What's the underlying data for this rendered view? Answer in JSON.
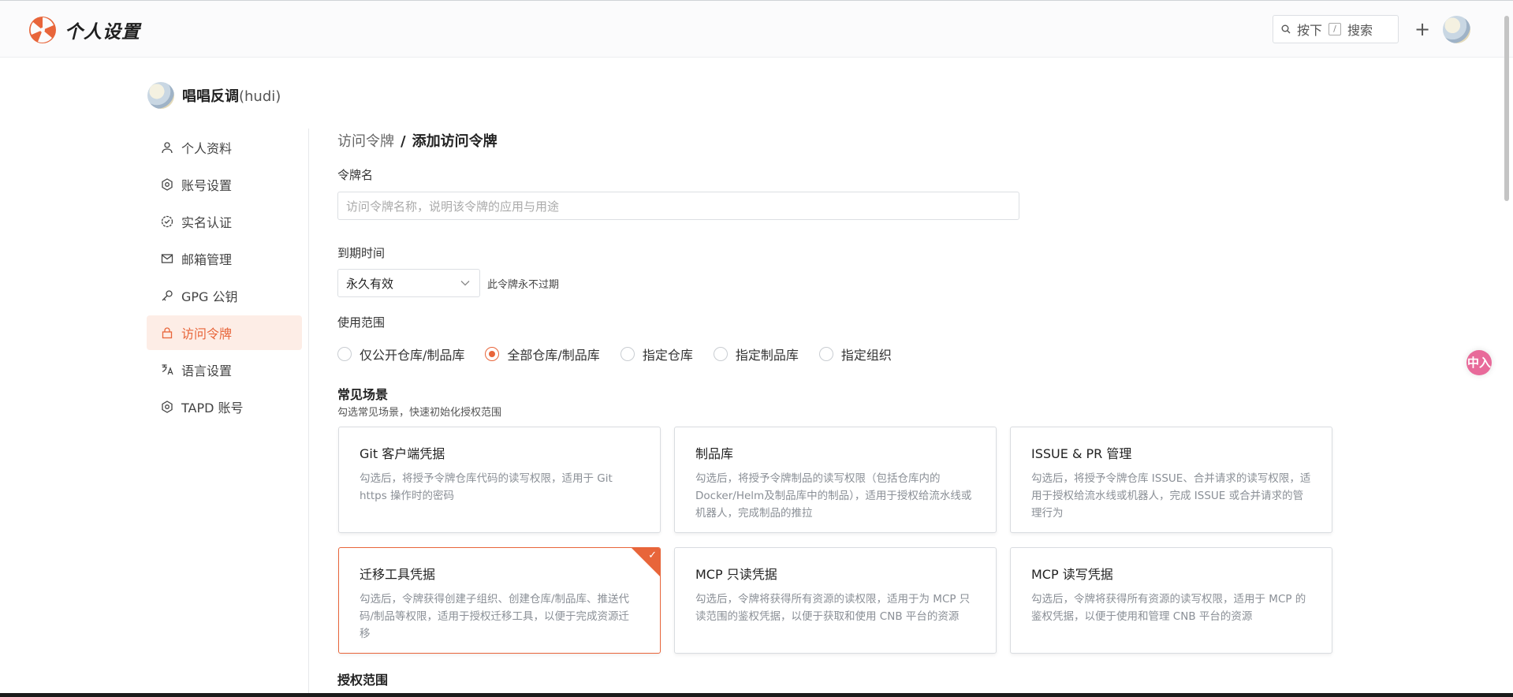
{
  "header": {
    "app_title": "个人设置",
    "search": {
      "prefix": "按下",
      "key": "/",
      "suffix": "搜索"
    },
    "plus_label": "+"
  },
  "profile": {
    "name": "唱唱反调",
    "handle": "(hudi)"
  },
  "sidebar": {
    "items": [
      {
        "label": "个人资料",
        "icon": "user-icon",
        "active": false
      },
      {
        "label": "账号设置",
        "icon": "gear-icon",
        "active": false
      },
      {
        "label": "实名认证",
        "icon": "verified-badge-icon",
        "active": false
      },
      {
        "label": "邮箱管理",
        "icon": "mail-icon",
        "active": false
      },
      {
        "label": "GPG 公钥",
        "icon": "key-icon",
        "active": false
      },
      {
        "label": "访问令牌",
        "icon": "lock-icon",
        "active": true
      },
      {
        "label": "语言设置",
        "icon": "language-icon",
        "active": false
      },
      {
        "label": "TAPD 账号",
        "icon": "gear-icon",
        "active": false
      }
    ]
  },
  "breadcrumb": {
    "parent": "访问令牌",
    "separator": "/",
    "current": "添加访问令牌"
  },
  "form": {
    "token_name_label": "令牌名",
    "token_name_placeholder": "访问令牌名称，说明该令牌的应用与用途",
    "expiry_label": "到期时间",
    "expiry_value": "永久有效",
    "expiry_hint": "此令牌永不过期",
    "scope_label": "使用范围",
    "scope_options": [
      {
        "label": "仅公开仓库/制品库",
        "checked": false
      },
      {
        "label": "全部仓库/制品库",
        "checked": true
      },
      {
        "label": "指定仓库",
        "checked": false
      },
      {
        "label": "指定制品库",
        "checked": false
      },
      {
        "label": "指定组织",
        "checked": false
      }
    ]
  },
  "scenarios": {
    "title": "常见场景",
    "subtitle": "勾选常见场景，快速初始化授权范围",
    "cards": [
      {
        "title": "Git 客户端凭据",
        "desc": "勾选后，将授予令牌仓库代码的读写权限，适用于 Git https 操作时的密码",
        "selected": false
      },
      {
        "title": "制品库",
        "desc": "勾选后，将授予令牌制品的读写权限（包括仓库内的 Docker/Helm及制品库中的制品），适用于授权给流水线或机器人，完成制品的推拉",
        "selected": false
      },
      {
        "title": "ISSUE & PR 管理",
        "desc": "勾选后，将授予令牌仓库 ISSUE、合并请求的读写权限，适用于授权给流水线或机器人，完成 ISSUE 或合并请求的管理行为",
        "selected": false
      },
      {
        "title": "迁移工具凭据",
        "desc": "勾选后，令牌获得创建子组织、创建仓库/制品库、推送代码/制品等权限，适用于授权迁移工具，以便于完成资源迁移",
        "selected": true
      },
      {
        "title": "MCP 只读凭据",
        "desc": "勾选后，令牌将获得所有资源的读权限，适用于为 MCP 只读范围的鉴权凭据，以便于获取和使用 CNB 平台的资源",
        "selected": false
      },
      {
        "title": "MCP 读写凭据",
        "desc": "勾选后，令牌将获得所有资源的读写权限，适用于 MCP 的鉴权凭据，以便于使用和管理 CNB 平台的资源",
        "selected": false
      }
    ]
  },
  "auth_scope": {
    "title": "授权范围"
  },
  "floating_badge": {
    "label": "中入"
  },
  "colors": {
    "accent": "#e8653a",
    "active_bg": "#fdede6",
    "border": "#dcdfe3"
  }
}
